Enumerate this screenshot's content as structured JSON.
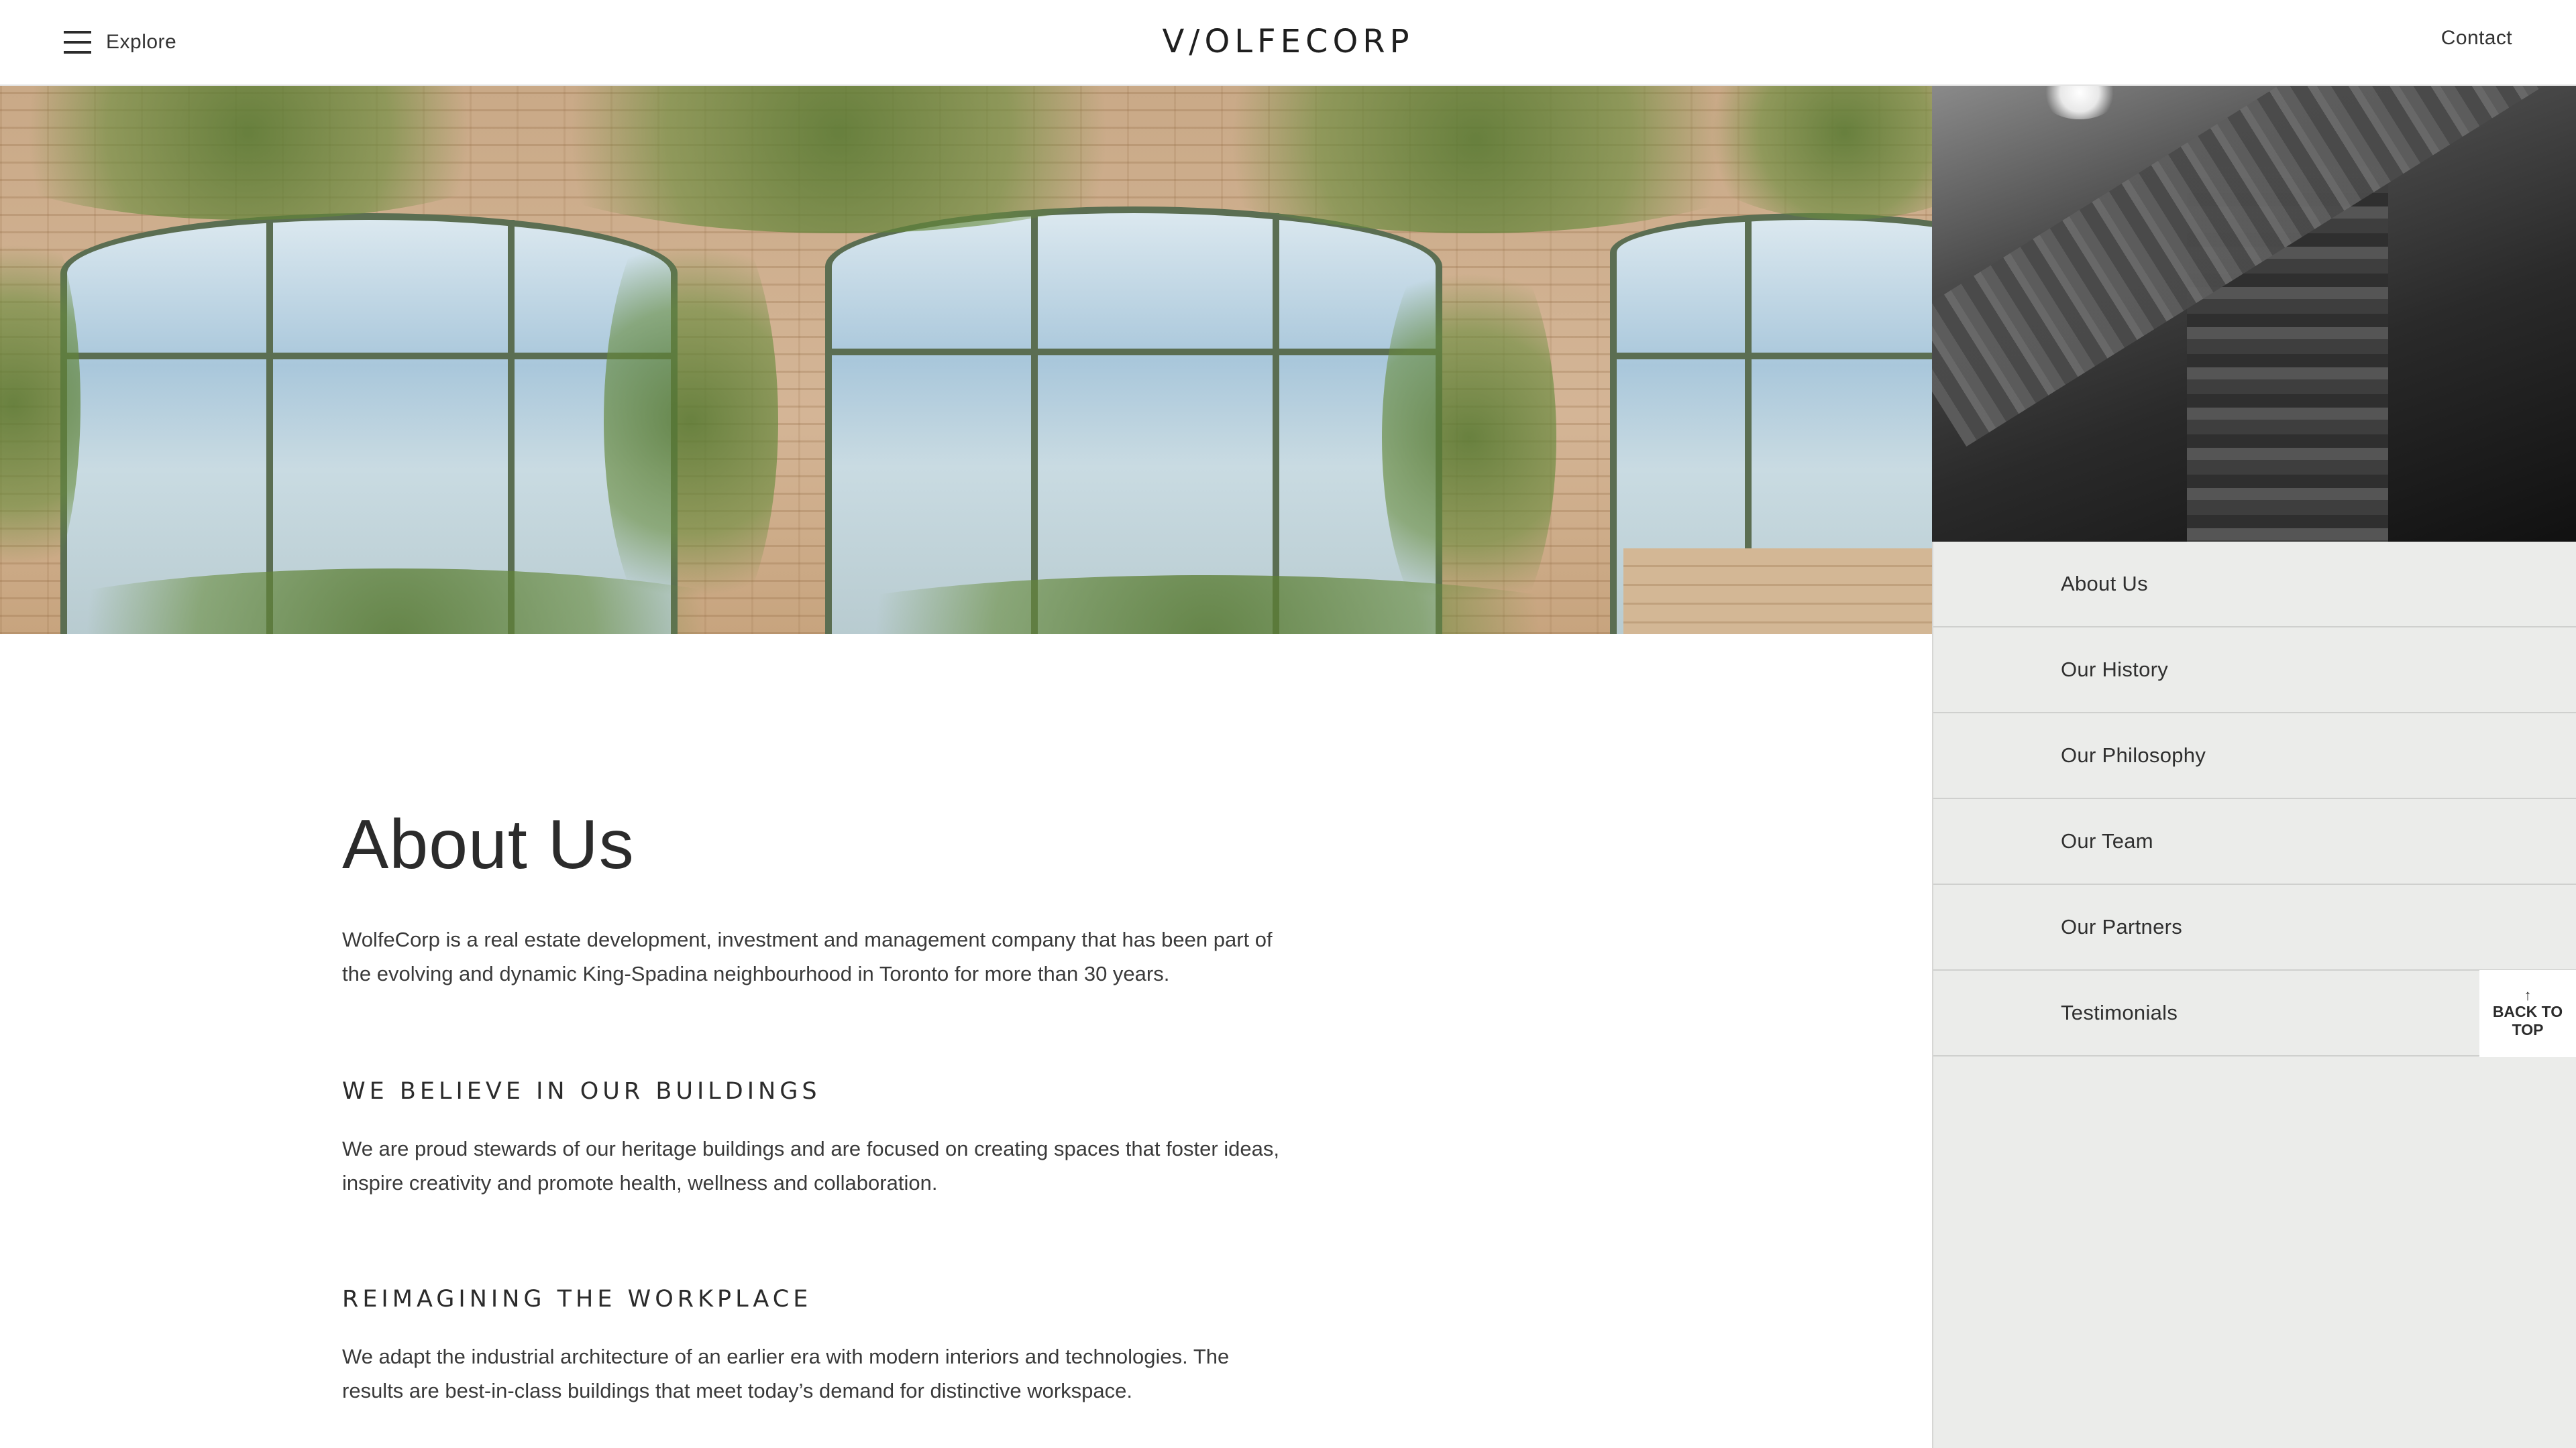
{
  "header": {
    "explore_label": "Explore",
    "logo_text": "V/OLFECORP",
    "contact_label": "Contact"
  },
  "icons": {
    "menu": "hamburger-menu-icon",
    "back_to_top": "arrow-up-icon"
  },
  "side_nav": {
    "items": [
      {
        "label": "About Us"
      },
      {
        "label": "Our History"
      },
      {
        "label": "Our Philosophy"
      },
      {
        "label": "Our Team"
      },
      {
        "label": "Our Partners"
      },
      {
        "label": "Testimonials"
      }
    ],
    "back_to_top": {
      "arrow": "↑",
      "label": "BACK TO TOP"
    }
  },
  "main": {
    "title": "About Us",
    "intro": "WolfeCorp is a real estate development, investment and management company that has been part of the evolving and dynamic King-Spadina neighbourhood in Toronto for more than 30 years.",
    "sections": [
      {
        "heading": "WE BELIEVE IN OUR BUILDINGS",
        "body": "We are proud stewards of our heritage buildings and are focused on creating spaces that foster ideas, inspire creativity and promote health, wellness and collaboration."
      },
      {
        "heading": "REIMAGINING THE WORKPLACE",
        "body": "We adapt the industrial architecture of an earlier era with modern interiors and technologies. The results are best-in-class buildings that meet today’s demand for distinctive workspace."
      }
    ]
  },
  "colors": {
    "text": "#2b2b2b",
    "side_nav_bg": "#ebecea",
    "divider": "#cfd0ce",
    "background": "#ffffff"
  }
}
